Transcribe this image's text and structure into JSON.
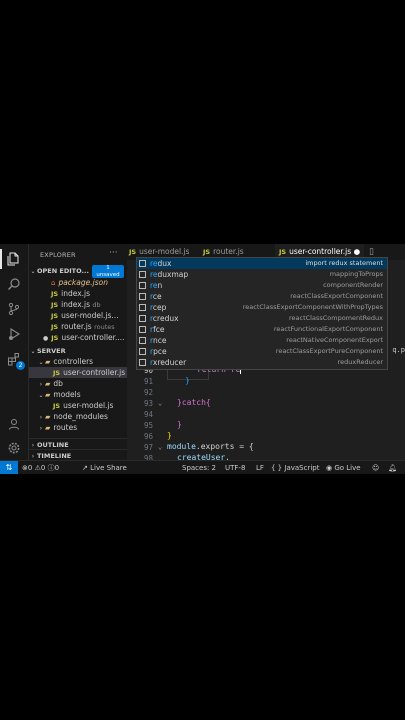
{
  "sidebar": {
    "title": "EXPLORER",
    "open_editors": {
      "label": "OPEN EDITO...",
      "badge_count": "1",
      "badge_text": "unsaved",
      "files": [
        {
          "icon": "XML",
          "name": "package.json",
          "hint": ""
        },
        {
          "icon": "JS",
          "name": "index.js",
          "hint": ""
        },
        {
          "icon": "JS",
          "name": "index.js",
          "hint": "db"
        },
        {
          "icon": "JS",
          "name": "user-model.js...",
          "hint": ""
        },
        {
          "icon": "JS",
          "name": "router.js",
          "hint": "routes"
        },
        {
          "icon": "JS",
          "name": "user-controller....",
          "hint": ""
        }
      ]
    },
    "server": {
      "label": "SERVER",
      "items": [
        {
          "name": "controllers"
        },
        {
          "name": "user-controller.js"
        },
        {
          "name": "db"
        },
        {
          "name": "models"
        },
        {
          "name": "user-model.js"
        },
        {
          "name": "node_modules"
        },
        {
          "name": "routes"
        }
      ]
    },
    "outline": "OUTLINE",
    "timeline": "TIMELINE"
  },
  "tabs": [
    {
      "name": "user-model.js"
    },
    {
      "name": "router.js"
    },
    {
      "name": "user-controller.js"
    }
  ],
  "icons": {
    "js": "JS",
    "xml": "XML"
  },
  "editor": {
    "breadcrumb_tail": "q.p",
    "lines": [
      {
        "n": "90",
        "code": "return re"
      },
      {
        "n": "91",
        "code": "}"
      },
      {
        "n": "92",
        "code": ""
      },
      {
        "n": "93",
        "code": "}catch{"
      },
      {
        "n": "94",
        "code": ""
      },
      {
        "n": "95",
        "code": "}"
      },
      {
        "n": "96",
        "code": "}"
      },
      {
        "n": "97",
        "code_a": "module",
        "code_b": ".exports = {"
      },
      {
        "n": "98",
        "code": "createUser,"
      }
    ]
  },
  "suggestions": [
    {
      "match": "re",
      "rest": "dux",
      "desc": "import redux statement"
    },
    {
      "match": "re",
      "rest": "duxmap",
      "desc": "mappingToProps"
    },
    {
      "match": "re",
      "rest": "n",
      "desc": "componentRender"
    },
    {
      "match": "r",
      "rest": "ce",
      "desc": "reactClassExportComponent"
    },
    {
      "match": "r",
      "rest": "cep",
      "desc": "reactClassExportComponentWithPropTypes"
    },
    {
      "match": "r",
      "rest": "credux",
      "desc": "reactClassCompomentRedux"
    },
    {
      "match": "r",
      "rest": "fce",
      "desc": "reactFunctionalExportComponent"
    },
    {
      "match": "r",
      "rest": "nce",
      "desc": "reactNativeComponentExport"
    },
    {
      "match": "r",
      "rest": "pce",
      "desc": "reactClassExportPureComponent"
    },
    {
      "match": "r",
      "rest": "xreducer",
      "desc": "reduxReducer"
    }
  ],
  "status": {
    "errors": "0",
    "warnings": "0",
    "info": "0",
    "live_share": "Live Share",
    "spaces": "Spaces: 2",
    "encoding": "UTF-8",
    "eol": "LF",
    "language": "JavaScript",
    "go_live": "Go Live"
  },
  "activity_badge": "2"
}
